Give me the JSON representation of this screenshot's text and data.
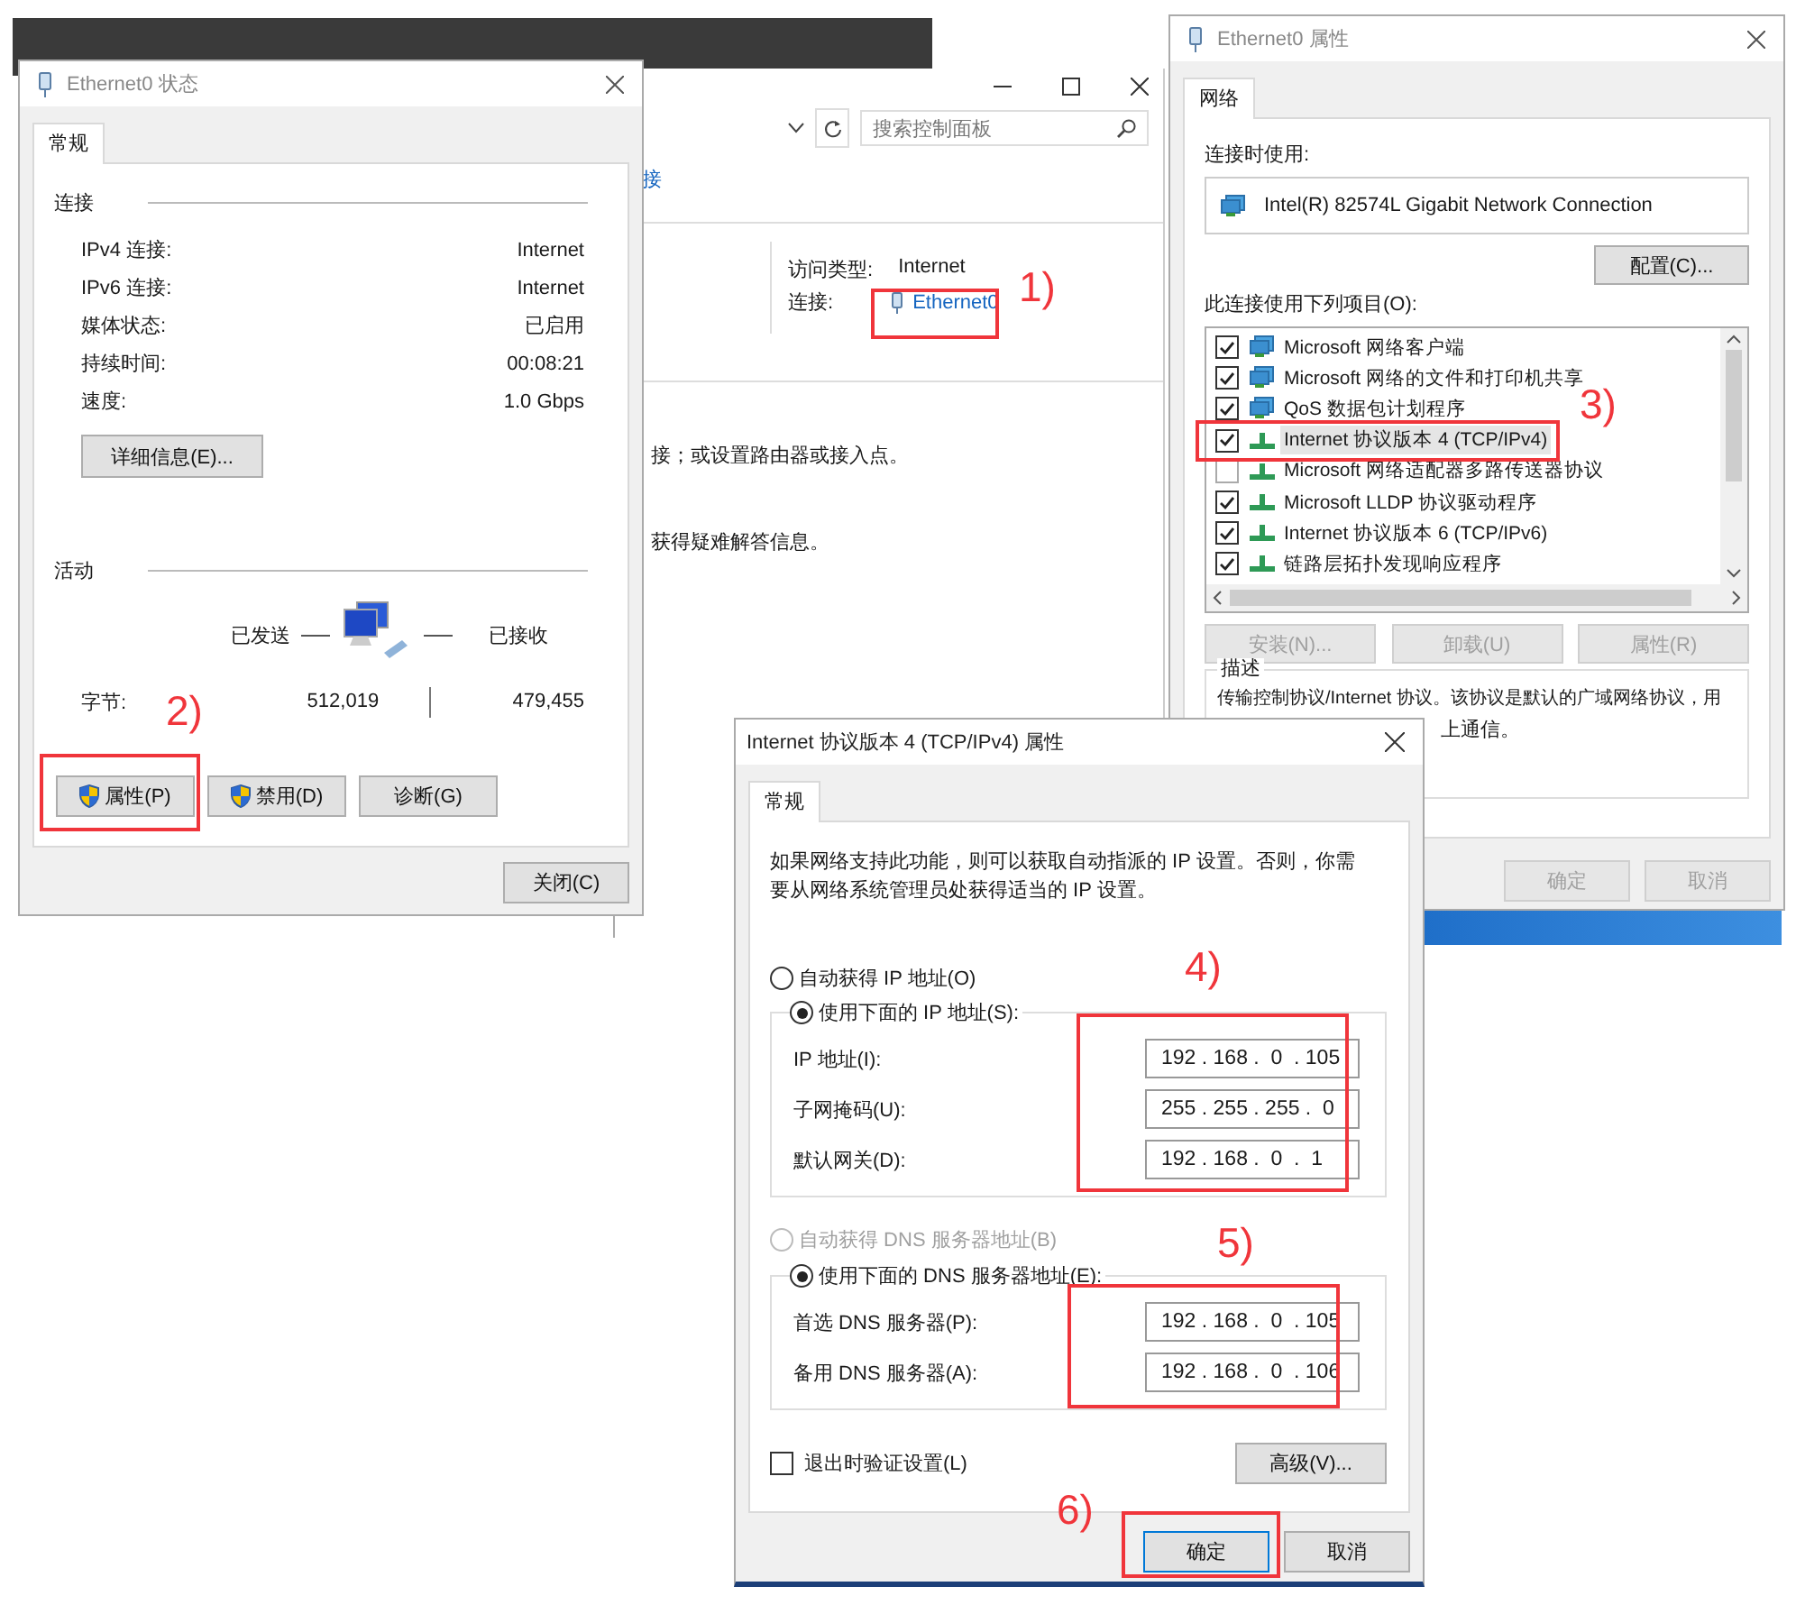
{
  "control_panel": {
    "search_placeholder": "搜索控制面板",
    "link_fragment": "接",
    "access_type_label": "访问类型:",
    "access_type_value": "Internet",
    "connection_label": "连接:",
    "connection_link": "Ethernet0",
    "text_lines": [
      "接；或设置路由器或接入点。",
      "获得疑难解答信息。"
    ]
  },
  "status_dialog": {
    "title": "Ethernet0 状态",
    "tabs": [
      {
        "label": "常规",
        "selected": true
      }
    ],
    "connection_heading": "连接",
    "rows": [
      {
        "label": "IPv4 连接:",
        "value": "Internet"
      },
      {
        "label": "IPv6 连接:",
        "value": "Internet"
      },
      {
        "label": "媒体状态:",
        "value": "已启用"
      },
      {
        "label": "持续时间:",
        "value": "00:08:21"
      },
      {
        "label": "速度:",
        "value": "1.0 Gbps"
      }
    ],
    "details_button": "详细信息(E)...",
    "activity_heading": "活动",
    "sent_label": "已发送",
    "received_label": "已接收",
    "bytes_label": "字节:",
    "bytes_sent": "512,019",
    "bytes_received": "479,455",
    "buttons": [
      {
        "label": "属性(P)",
        "shield": true
      },
      {
        "label": "禁用(D)",
        "shield": true
      },
      {
        "label": "诊断(G)",
        "shield": false
      }
    ],
    "close_button": "关闭(C)"
  },
  "properties_dialog": {
    "title": "Ethernet0 属性",
    "tabs": [
      {
        "label": "网络",
        "selected": true
      }
    ],
    "connect_using_label": "连接时使用:",
    "adapter": "Intel(R) 82574L Gigabit Network Connection",
    "configure_button": "配置(C)...",
    "items_label": "此连接使用下列项目(O):",
    "items": [
      {
        "label": "Microsoft 网络客户端",
        "kind": "client",
        "checked": true,
        "selected": false
      },
      {
        "label": "Microsoft 网络的文件和打印机共享",
        "kind": "client",
        "checked": true,
        "selected": false
      },
      {
        "label": "QoS 数据包计划程序",
        "kind": "client",
        "checked": true,
        "selected": false
      },
      {
        "label": "Internet 协议版本 4 (TCP/IPv4)",
        "kind": "protocol",
        "checked": true,
        "selected": true
      },
      {
        "label": "Microsoft 网络适配器多路传送器协议",
        "kind": "protocol",
        "checked": false,
        "selected": false
      },
      {
        "label": "Microsoft LLDP 协议驱动程序",
        "kind": "protocol",
        "checked": true,
        "selected": false
      },
      {
        "label": "Internet 协议版本 6 (TCP/IPv6)",
        "kind": "protocol",
        "checked": true,
        "selected": false
      },
      {
        "label": "链路层拓扑发现响应程序",
        "kind": "protocol",
        "checked": true,
        "selected": false
      }
    ],
    "item_buttons": [
      {
        "label": "安装(N)...",
        "disabled": true
      },
      {
        "label": "卸载(U)",
        "disabled": true
      },
      {
        "label": "属性(R)",
        "disabled": true
      }
    ],
    "description_heading": "描述",
    "description_lines": [
      "传输控制协议/Internet 协议。该协议是默认的广域网络协议，用",
      "上通信。"
    ],
    "footer_buttons": [
      {
        "label": "确定",
        "disabled": true
      },
      {
        "label": "取消",
        "disabled": true
      }
    ]
  },
  "ipv4_dialog": {
    "title": "Internet 协议版本 4 (TCP/IPv4) 属性",
    "tabs": [
      {
        "label": "常规",
        "selected": true
      }
    ],
    "intro": "如果网络支持此功能，则可以获取自动指派的 IP 设置。否则，你需要从网络系统管理员处获得适当的 IP 设置。",
    "ip_options": [
      {
        "label": "自动获得 IP 地址(O)",
        "selected": false,
        "disabled": false
      },
      {
        "label": "使用下面的 IP 地址(S):",
        "selected": true,
        "disabled": false
      }
    ],
    "ip_fields": [
      {
        "label": "IP 地址(I):",
        "value": "192 . 168 .  0  . 105"
      },
      {
        "label": "子网掩码(U):",
        "value": "255 . 255 . 255 .  0"
      },
      {
        "label": "默认网关(D):",
        "value": "192 . 168 .  0  .  1"
      }
    ],
    "dns_options": [
      {
        "label": "自动获得 DNS 服务器地址(B)",
        "selected": false,
        "disabled": true
      },
      {
        "label": "使用下面的 DNS 服务器地址(E):",
        "selected": true,
        "disabled": false
      }
    ],
    "dns_fields": [
      {
        "label": "首选 DNS 服务器(P):",
        "value": "192 . 168 .  0  . 105"
      },
      {
        "label": "备用 DNS 服务器(A):",
        "value": "192 . 168 .  0  . 106"
      }
    ],
    "validate_checkbox": {
      "label": "退出时验证设置(L)",
      "checked": false
    },
    "advanced_button": "高级(V)...",
    "ok_button": "确定",
    "cancel_button": "取消"
  },
  "annotations": [
    {
      "label": "1)"
    },
    {
      "label": "2)"
    },
    {
      "label": "3)"
    },
    {
      "label": "4)"
    },
    {
      "label": "5)"
    },
    {
      "label": "6)"
    }
  ]
}
